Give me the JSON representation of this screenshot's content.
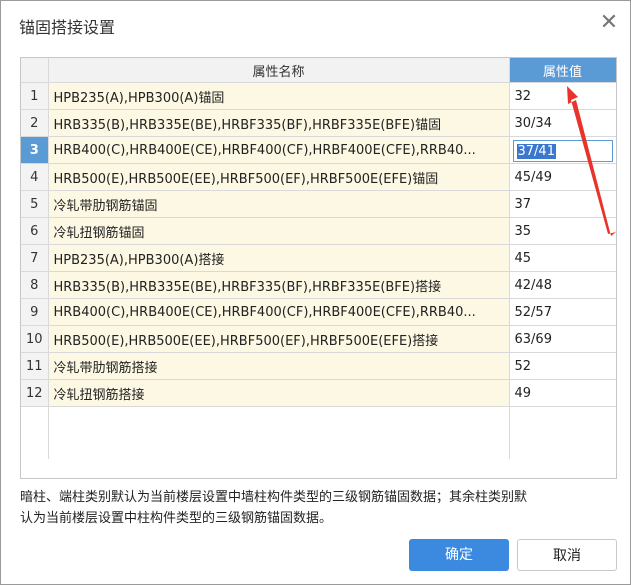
{
  "dialog": {
    "title": "锚固搭接设置",
    "close_glyph": "✕"
  },
  "table": {
    "headers": {
      "name": "属性名称",
      "value": "属性值"
    },
    "rows": [
      {
        "num": "1",
        "name": "HPB235(A),HPB300(A)锚固",
        "value": "32"
      },
      {
        "num": "2",
        "name": "HRB335(B),HRB335E(BE),HRBF335(BF),HRBF335E(BFE)锚固",
        "value": "30/34"
      },
      {
        "num": "3",
        "name": "HRB400(C),HRB400E(CE),HRBF400(CF),HRBF400E(CFE),RRB40...",
        "value": "37/41"
      },
      {
        "num": "4",
        "name": "HRB500(E),HRB500E(EE),HRBF500(EF),HRBF500E(EFE)锚固",
        "value": "45/49"
      },
      {
        "num": "5",
        "name": "冷轧带肋钢筋锚固",
        "value": "37"
      },
      {
        "num": "6",
        "name": "冷轧扭钢筋锚固",
        "value": "35"
      },
      {
        "num": "7",
        "name": "HPB235(A),HPB300(A)搭接",
        "value": "45"
      },
      {
        "num": "8",
        "name": "HRB335(B),HRB335E(BE),HRBF335(BF),HRBF335E(BFE)搭接",
        "value": "42/48"
      },
      {
        "num": "9",
        "name": "HRB400(C),HRB400E(CE),HRBF400(CF),HRBF400E(CFE),RRB40...",
        "value": "52/57"
      },
      {
        "num": "10",
        "name": "HRB500(E),HRB500E(EE),HRBF500(EF),HRBF500E(EFE)搭接",
        "value": "63/69"
      },
      {
        "num": "11",
        "name": "冷轧带肋钢筋搭接",
        "value": "52"
      },
      {
        "num": "12",
        "name": "冷轧扭钢筋搭接",
        "value": "49"
      }
    ],
    "selected_row": 3
  },
  "note": {
    "line1": "暗柱、端柱类别默认为当前楼层设置中墙柱构件类型的三级钢筋锚固数据；其余柱类别默",
    "line2": "认为当前楼层设置中柱构件类型的三级钢筋锚固数据。"
  },
  "buttons": {
    "ok": "确定",
    "cancel": "取消"
  },
  "colors": {
    "accent": "#5b9bd5",
    "name_cell_bg": "#fdf8e3",
    "ok_button": "#3b8ae0",
    "annotation_arrow": "#e8332a"
  }
}
